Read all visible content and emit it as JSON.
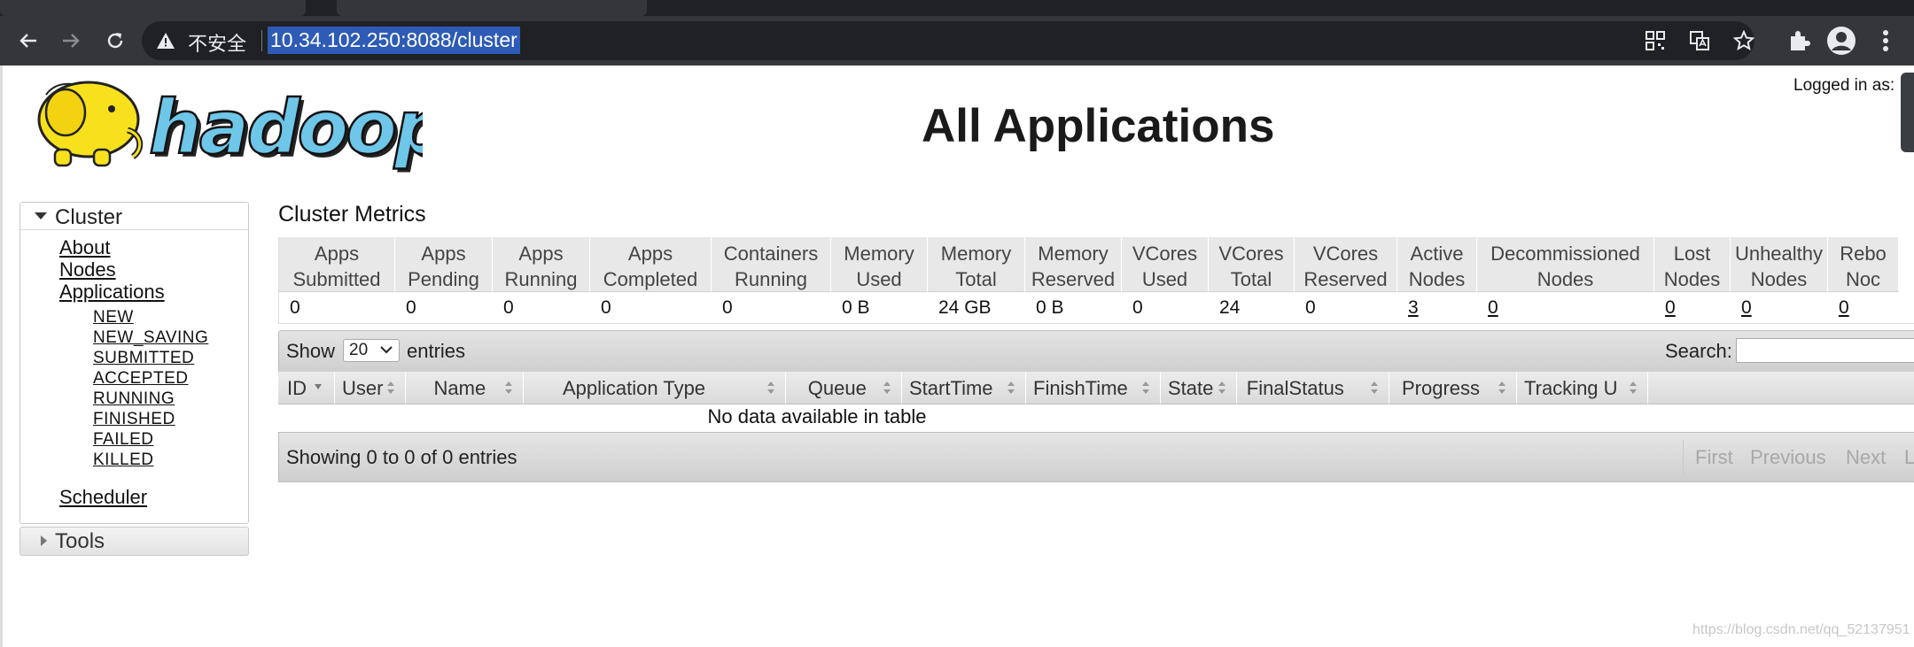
{
  "browser": {
    "security_label": "不安全",
    "url": "10.34.102.250:8088/cluster"
  },
  "header": {
    "logo_text": "hadoop",
    "title": "All Applications",
    "logged_in": "Logged in as:"
  },
  "sidebar": {
    "cluster_label": "Cluster",
    "links": [
      "About",
      "Nodes",
      "Applications"
    ],
    "app_states": [
      "NEW",
      "NEW_SAVING",
      "SUBMITTED",
      "ACCEPTED",
      "RUNNING",
      "FINISHED",
      "FAILED",
      "KILLED"
    ],
    "scheduler_label": "Scheduler",
    "tools_label": "Tools"
  },
  "cluster_metrics": {
    "title": "Cluster Metrics",
    "columns": [
      {
        "h1": "Apps",
        "h2": "Submitted",
        "value": "0",
        "link": false
      },
      {
        "h1": "Apps",
        "h2": "Pending",
        "value": "0",
        "link": false
      },
      {
        "h1": "Apps",
        "h2": "Running",
        "value": "0",
        "link": false
      },
      {
        "h1": "Apps",
        "h2": "Completed",
        "value": "0",
        "link": false
      },
      {
        "h1": "Containers",
        "h2": "Running",
        "value": "0",
        "link": false
      },
      {
        "h1": "Memory",
        "h2": "Used",
        "value": "0 B",
        "link": false
      },
      {
        "h1": "Memory",
        "h2": "Total",
        "value": "24 GB",
        "link": false
      },
      {
        "h1": "Memory",
        "h2": "Reserved",
        "value": "0 B",
        "link": false
      },
      {
        "h1": "VCores",
        "h2": "Used",
        "value": "0",
        "link": false
      },
      {
        "h1": "VCores",
        "h2": "Total",
        "value": "24",
        "link": false
      },
      {
        "h1": "VCores",
        "h2": "Reserved",
        "value": "0",
        "link": false
      },
      {
        "h1": "Active",
        "h2": "Nodes",
        "value": "3",
        "link": true
      },
      {
        "h1": "Decommissioned",
        "h2": "Nodes",
        "value": "0",
        "link": true
      },
      {
        "h1": "Lost",
        "h2": "Nodes",
        "value": "0",
        "link": true
      },
      {
        "h1": "Unhealthy",
        "h2": "Nodes",
        "value": "0",
        "link": true
      },
      {
        "h1": "Rebo",
        "h2": "Noc",
        "value": "0",
        "link": true
      }
    ]
  },
  "apps_table": {
    "show_label": "Show",
    "page_size": "20",
    "entries_label": "entries",
    "search_label": "Search:",
    "search_value": "",
    "headers": [
      "ID",
      "User",
      "Name",
      "Application Type",
      "Queue",
      "StartTime",
      "FinishTime",
      "State",
      "FinalStatus",
      "Progress",
      "Tracking U"
    ],
    "empty_text": "No data available in table",
    "info": "Showing 0 to 0 of 0 entries",
    "pager": [
      "First",
      "Previous",
      "Next",
      "L"
    ]
  },
  "watermark": "https://blog.csdn.net/qq_52137951"
}
